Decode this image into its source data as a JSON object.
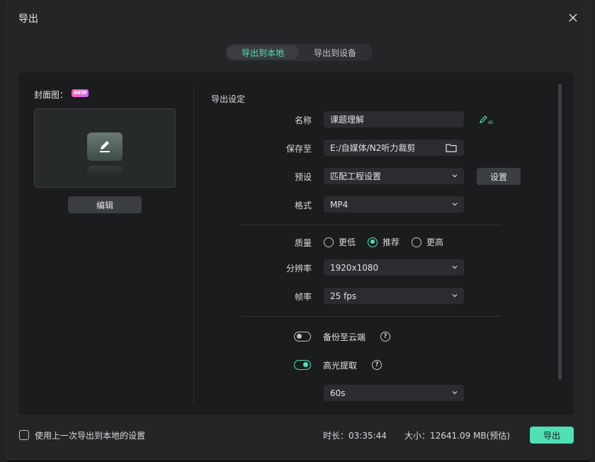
{
  "dialog": {
    "title": "导出"
  },
  "tabs": [
    {
      "label": "导出到本地",
      "active": true
    },
    {
      "label": "导出到设备",
      "active": false
    }
  ],
  "cover": {
    "label": "封面图：",
    "badge": "NEW",
    "edit_label": "编辑"
  },
  "settings": {
    "section_title": "导出设定",
    "name": {
      "label": "名称",
      "value": "课题理解"
    },
    "save_to": {
      "label": "保存至",
      "value": "E:/自媒体/N2听力裁剪"
    },
    "preset": {
      "label": "预设",
      "value": "匹配工程设置",
      "button": "设置"
    },
    "format": {
      "label": "格式",
      "value": "MP4"
    },
    "quality": {
      "label": "质量",
      "options": [
        "更低",
        "推荐",
        "更高"
      ],
      "selected": "推荐"
    },
    "resolution": {
      "label": "分辨率",
      "value": "1920x1080"
    },
    "framerate": {
      "label": "帧率",
      "value": "25 fps"
    },
    "cloud_backup": {
      "label": "备份至云端",
      "enabled": false
    },
    "highlight": {
      "label": "高光提取",
      "enabled": true,
      "duration": "60s"
    }
  },
  "footer": {
    "remember_label": "使用上一次导出到本地的设置",
    "duration": "时长：03:35:44",
    "size": "大小：12641.09 MB(预估)",
    "export_label": "导出"
  },
  "colors": {
    "accent": "#4fe0b6",
    "panel": "#1b1c1e",
    "dialog": "#232527"
  }
}
